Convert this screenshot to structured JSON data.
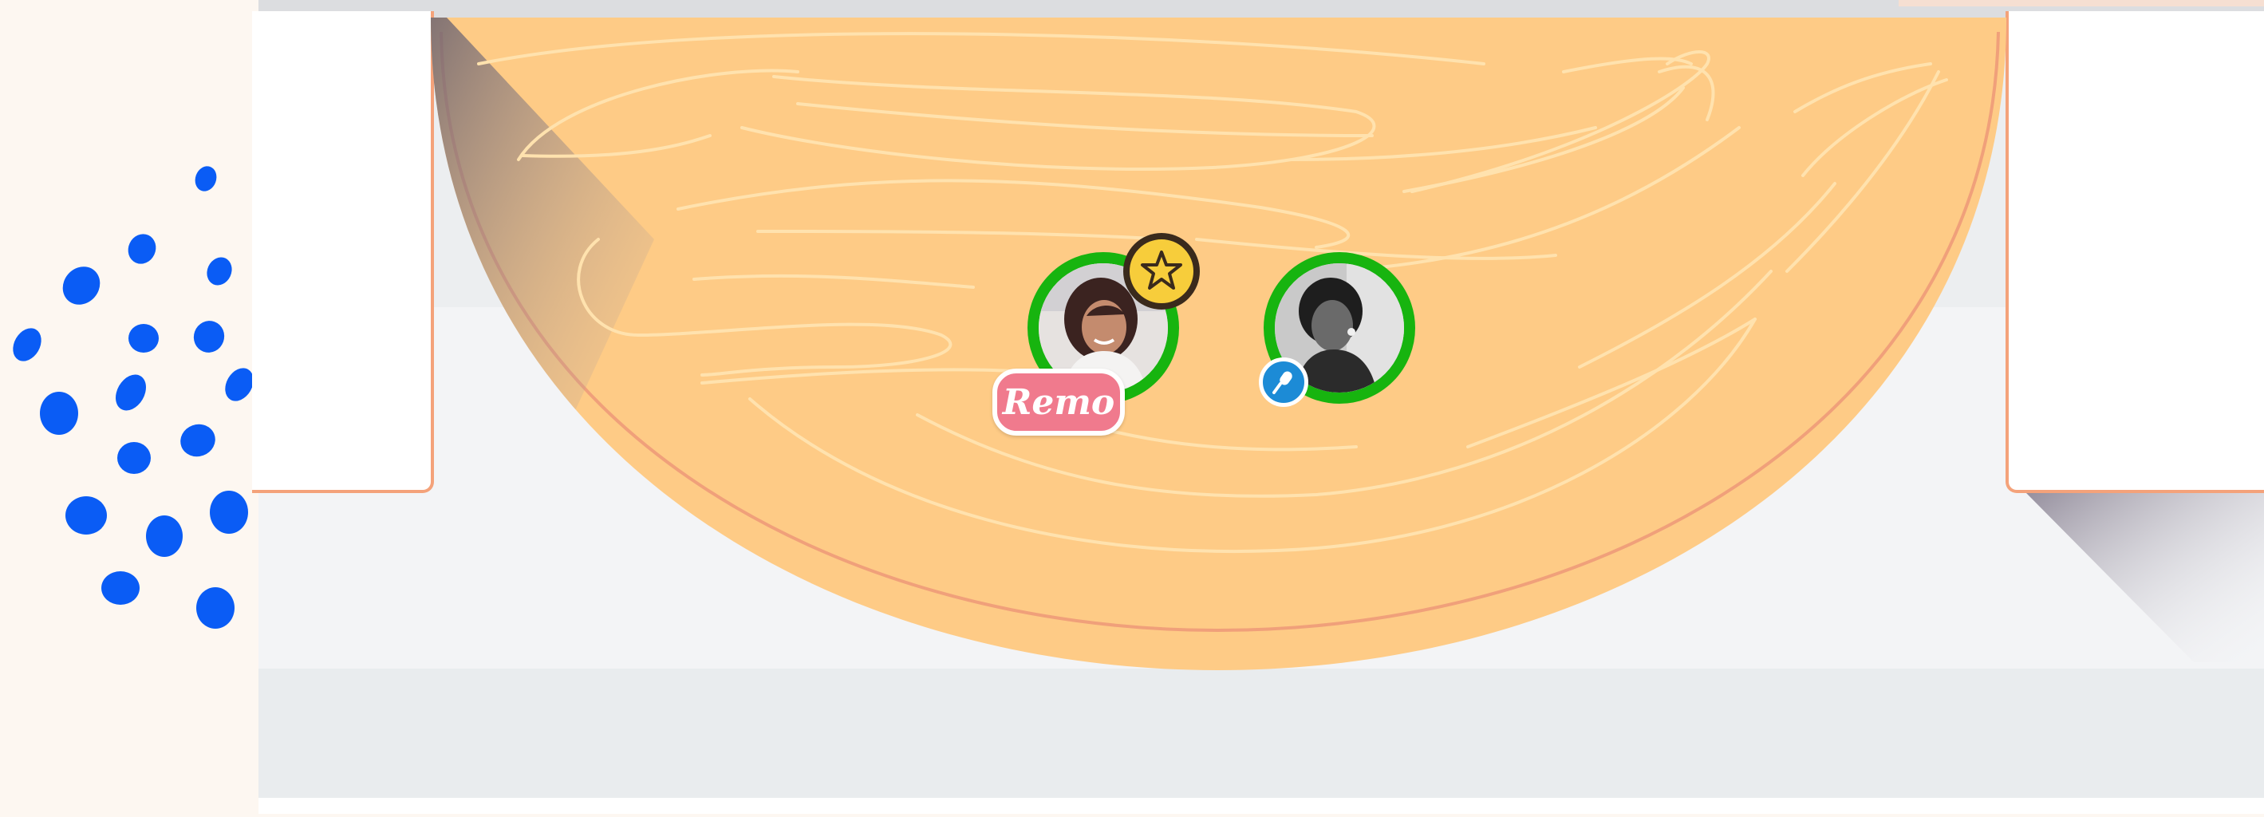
{
  "room": {
    "table": {
      "seats": [
        {
          "avatar": "participant-avatar",
          "status_color": "#17b40f",
          "badge": "star-icon",
          "name_tag": "Remo"
        },
        {
          "avatar": "participant-avatar",
          "status_color": "#17b40f",
          "badge": "microphone-icon"
        }
      ]
    }
  },
  "colors": {
    "table_fill": "#fecb86",
    "table_rim": "#f4a27a",
    "wood_grain": "#ffe2ae",
    "presence_ring": "#17b40f",
    "name_tag": "#f07a8d",
    "mic_badge": "#1c8bd6",
    "star_badge": "#f7cd3b",
    "paint_dots": "#0a5cf5"
  }
}
